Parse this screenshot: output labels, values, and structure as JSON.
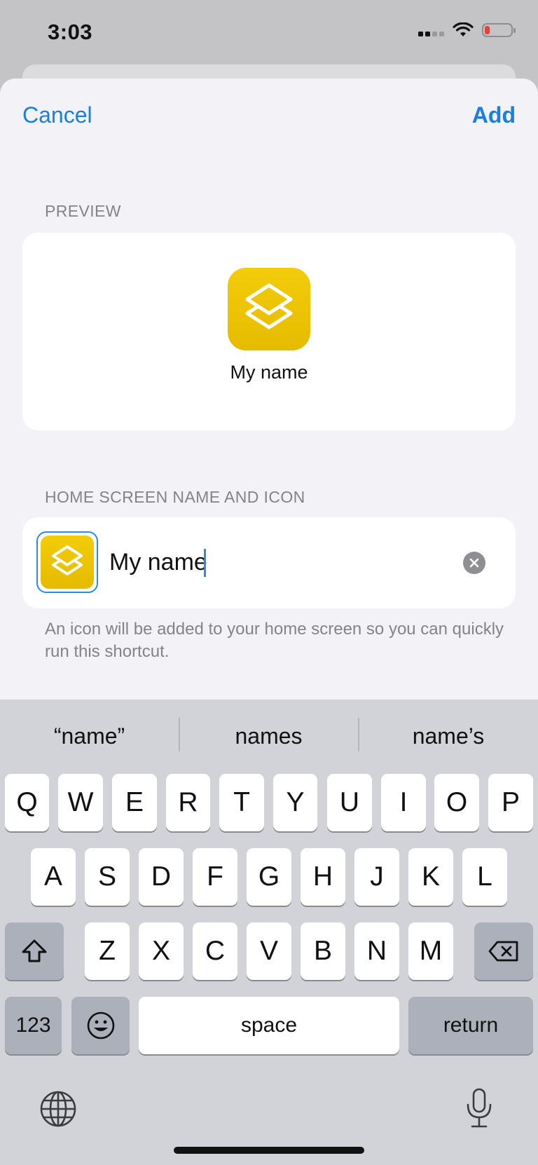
{
  "status": {
    "time": "3:03"
  },
  "nav": {
    "cancel": "Cancel",
    "add": "Add"
  },
  "preview": {
    "label": "PREVIEW",
    "name": "My name"
  },
  "home": {
    "label": "HOME SCREEN NAME AND ICON",
    "value": "My name",
    "helper": "An icon will be added to your home screen so you can quickly run this shortcut."
  },
  "keyboard": {
    "suggestions": [
      "“name”",
      "names",
      "name’s"
    ],
    "row1": [
      "Q",
      "W",
      "E",
      "R",
      "T",
      "Y",
      "U",
      "I",
      "O",
      "P"
    ],
    "row2": [
      "A",
      "S",
      "D",
      "F",
      "G",
      "H",
      "J",
      "K",
      "L"
    ],
    "row3": [
      "Z",
      "X",
      "C",
      "V",
      "B",
      "N",
      "M"
    ],
    "numbers": "123",
    "space": "space",
    "return": "return"
  },
  "colors": {
    "accent": "#1a7fe0",
    "icon": "#f0c800",
    "battery_low": "#e5413a"
  }
}
